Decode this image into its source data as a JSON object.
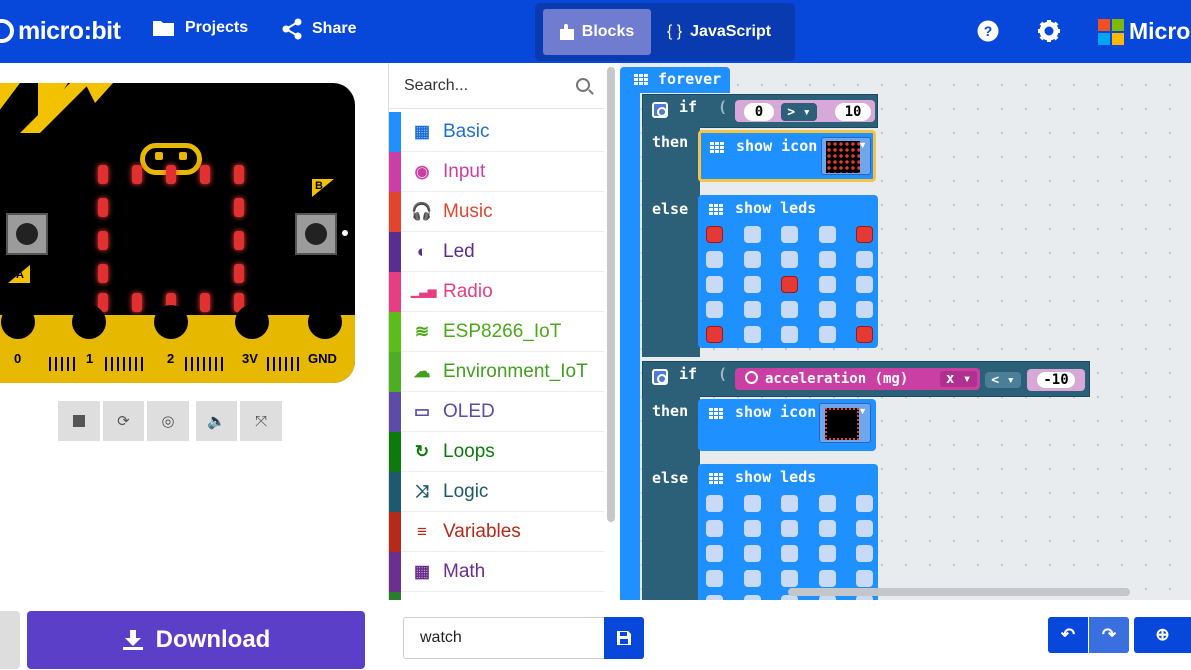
{
  "header": {
    "logo_text": "micro:bit",
    "projects_label": "Projects",
    "share_label": "Share",
    "blocks_label": "Blocks",
    "javascript_label": "JavaScript",
    "js_glyph": "{ }",
    "brand_text": "Micros",
    "help_icon": "question-circle-icon",
    "settings_icon": "gear-icon",
    "color": "#0748db"
  },
  "simulator": {
    "button_a": "A",
    "button_b": "B",
    "pins": [
      "0",
      "1",
      "2",
      "3V",
      "GND"
    ],
    "controls": [
      "stop-icon",
      "restart-icon",
      "slow-mo-icon",
      "sound-icon",
      "fullscreen-icon"
    ]
  },
  "toolbox": {
    "search_placeholder": "Search...",
    "categories": [
      {
        "label": "Basic",
        "color": "#1e90ff",
        "glyph": "▦"
      },
      {
        "label": "Input",
        "color": "#c93fa3",
        "glyph": "◉"
      },
      {
        "label": "Music",
        "color": "#e2452f",
        "glyph": "🎧"
      },
      {
        "label": "Led",
        "color": "#5c2d91",
        "glyph": "◐"
      },
      {
        "label": "Radio",
        "color": "#e63e83",
        "glyph": "▁▃▅"
      },
      {
        "label": "ESP8266_IoT",
        "color": "#5bbd1a",
        "glyph": "≋"
      },
      {
        "label": "Environment_IoT",
        "color": "#4caf22",
        "glyph": "☁"
      },
      {
        "label": "OLED",
        "color": "#5c4ba8",
        "glyph": "▭"
      },
      {
        "label": "Loops",
        "color": "#0e7a0e",
        "glyph": "↻"
      },
      {
        "label": "Logic",
        "color": "#1e5a6d",
        "glyph": "⤨"
      },
      {
        "label": "Variables",
        "color": "#b52a18",
        "glyph": "≡"
      },
      {
        "label": "Math",
        "color": "#6b2f8f",
        "glyph": "▦"
      }
    ]
  },
  "workspace": {
    "forever_label": "forever",
    "if1": {
      "if_label": "if",
      "left_value": "0",
      "operator": ">",
      "right_value": "10",
      "then_label": "then",
      "then_block": "show icon",
      "else_label": "else",
      "else_block": "show leds",
      "leds": [
        [
          1,
          0,
          0,
          0,
          1
        ],
        [
          0,
          0,
          0,
          0,
          0
        ],
        [
          0,
          0,
          1,
          0,
          0
        ],
        [
          0,
          0,
          0,
          0,
          0
        ],
        [
          1,
          0,
          0,
          0,
          1
        ]
      ]
    },
    "if2": {
      "if_label": "if",
      "sensor": "acceleration (mg)",
      "axis": "x",
      "operator": "<",
      "right_value": "-10",
      "then_label": "then",
      "then_block": "show icon",
      "else_label": "else",
      "else_block": "show leds",
      "leds": [
        [
          0,
          0,
          0,
          0,
          0
        ],
        [
          0,
          0,
          0,
          0,
          0
        ],
        [
          0,
          0,
          0,
          0,
          0
        ],
        [
          0,
          0,
          0,
          0,
          0
        ],
        [
          0,
          0,
          0,
          0,
          0
        ]
      ]
    }
  },
  "bottom": {
    "download_label": "Download",
    "project_name": "watch"
  }
}
